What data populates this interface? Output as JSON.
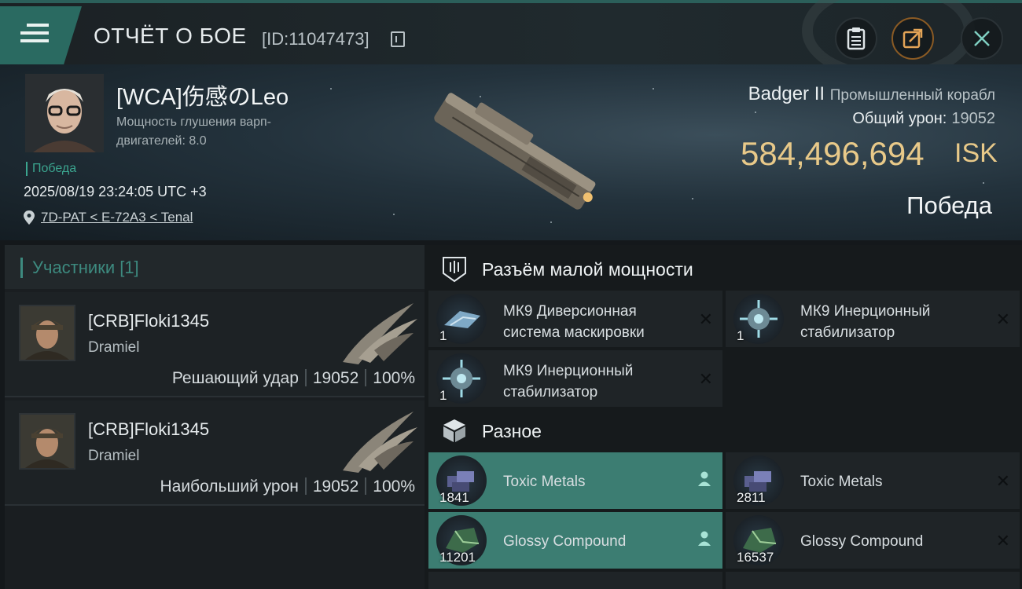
{
  "header": {
    "title": "ОТЧЁТ О БОЕ",
    "report_id": "[ID:11047473]",
    "icons": [
      "menu-icon",
      "copy-icon",
      "clipboard-icon",
      "share-icon",
      "close-icon"
    ]
  },
  "victim": {
    "name": "[WCA]伤感のLeo",
    "attribute": "Мощность глушения варп-двигателей: 8.0",
    "result_tag": "Победа",
    "datetime": "2025/08/19 23:24:05 UTC +3",
    "location": "7D-PAT < E-72A3 < Tenal",
    "ship_name": "Badger II",
    "ship_class": "Промышленный корабл",
    "damage_label": "Общий урон:",
    "damage_value": "19052",
    "isk_value": "584,496,694",
    "isk_currency": "ISK",
    "outcome": "Победа"
  },
  "participants": {
    "header": "Участники [1]",
    "rows": [
      {
        "name": "[CRB]Floki1345",
        "ship": "Dramiel",
        "role": "Решающий удар",
        "damage": "19052",
        "percent": "100%"
      },
      {
        "name": "[CRB]Floki1345",
        "ship": "Dramiel",
        "role": "Наибольший урон",
        "damage": "19052",
        "percent": "100%"
      }
    ]
  },
  "fitting": {
    "low_slot_title": "Разъём малой мощности",
    "low_slots": [
      {
        "name": "МК9 Диверсионная система маскировки",
        "qty": "1",
        "icon": "cloak-module-icon"
      },
      {
        "name": "МК9 Инерционный стабилизатор",
        "qty": "1",
        "icon": "stabilizer-module-icon"
      },
      {
        "name": "МК9 Инерционный стабилизатор",
        "qty": "1",
        "icon": "stabilizer-module-icon"
      }
    ],
    "misc_title": "Разное",
    "misc_items": [
      {
        "name": "Toxic Metals",
        "qty": "1841",
        "dropped": true
      },
      {
        "name": "Toxic Metals",
        "qty": "2811",
        "dropped": false
      },
      {
        "name": "Glossy Compound",
        "qty": "11201",
        "dropped": true
      },
      {
        "name": "Glossy Compound",
        "qty": "16537",
        "dropped": false
      }
    ]
  },
  "colors": {
    "accent": "#3d8a7f",
    "isk": "#e8c989",
    "dropped_bg": "#3c7d72"
  }
}
